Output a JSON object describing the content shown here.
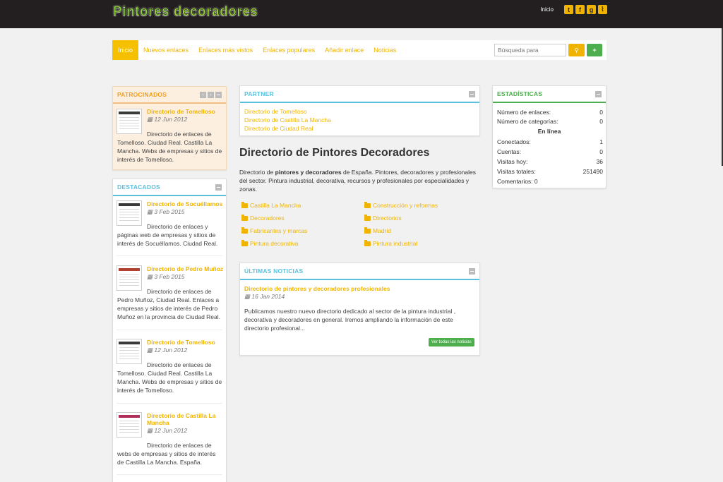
{
  "header": {
    "logo_word1": "Pintores",
    "logo_word2": "decoradores",
    "inicio": "Inicio",
    "social": [
      "twitter-icon",
      "facebook-icon",
      "google-plus-icon",
      "rss-icon"
    ]
  },
  "nav": {
    "items": [
      "Inicio",
      "Nuevos enlaces",
      "Enlaces más vistos",
      "Enlaces populares",
      "Añadir enlace",
      "Noticias"
    ],
    "search_placeholder": "Búsqueda para"
  },
  "sponsored": {
    "title": "PATROCINADOS",
    "entry": {
      "title": "Directorio de Tomelloso",
      "date": "12 Jun 2012",
      "desc": "Directorio de enlaces de Tomelloso. Ciudad Real. Castilla La Mancha. Webs de empresas y sitios de interés de Tomelloso."
    }
  },
  "featured": {
    "title": "DESTACADOS",
    "entries": [
      {
        "title": "Directorio de Socuéllamos",
        "date": "3 Feb 2015",
        "desc": "Directorio de enlaces y páginas web de empresas y sitios de interés de Socuéllamos. Ciudad Real."
      },
      {
        "title": "Directorio de Pedro Muñoz",
        "date": "3 Feb 2015",
        "desc": "Directorio de enlaces de Pedro Muñoz, Ciudad Real. Enlaces a empresas y sitios de interés de Pedro Muñoz en la provincia de Ciudad Real."
      },
      {
        "title": "Directorio de Tomelloso",
        "date": "12 Jun 2012",
        "desc": "Directorio de enlaces de Tomelloso. Ciudad Real. Castilla La Mancha. Webs de empresas y sitios de interés de Tomelloso."
      },
      {
        "title": "Directorio de Castilla La Mancha",
        "date": "12 Jun 2012",
        "desc": "Directorio de enlaces de webs de empresas y sitios de interés de Castilla La Mancha. España."
      }
    ]
  },
  "partner": {
    "title": "PARTNER",
    "links": [
      "Directorio de Tomelloso",
      "Directorio de Castilla La Mancha",
      "Directorio de Ciudad Real"
    ]
  },
  "main": {
    "title": "Directorio de Pintores Decoradores",
    "intro_pre": "Directorio de ",
    "intro_bold": "pintores y decoradores",
    "intro_post": " de España. Pintores, decoradores y profesionales del sector. Pintura industrial, decorativa, recursos y profesionales por especialidades y zonas.",
    "categories": [
      "Castilla La Mancha",
      "Construcción y reformas",
      "Decoradores",
      "Directorios",
      "Fabricantes y marcas",
      "Madrid",
      "Pintura decorativa",
      "Pintura industrial"
    ]
  },
  "news": {
    "title": "ÚLTIMAS NOTICIAS",
    "item_title": "Directorio de pintores y decoradores profesionales",
    "item_date": "16 Jan 2014",
    "item_desc": "Publicamos nuestro nuevo directorio dedicado al sector de la pintura industrial , decorativa y decoradores en general. Iremos ampliando la información de este directorio profesional...",
    "button": "Ver todas las noticias"
  },
  "stats": {
    "title": "ESTADÍSTICAS",
    "links_label": "Número de enlaces:",
    "links_value": "0",
    "cats_label": "Número de categorías:",
    "cats_value": "0",
    "online_title": "En línea",
    "connected_label": "Conectados:",
    "connected_value": "1",
    "accounts_label": "Cuentas:",
    "accounts_value": "0",
    "today_label": "Visitas hoy:",
    "today_value": "36",
    "total_label": "Visitas totales:",
    "total_value": "251490",
    "comments": "Comentarios: 0"
  }
}
